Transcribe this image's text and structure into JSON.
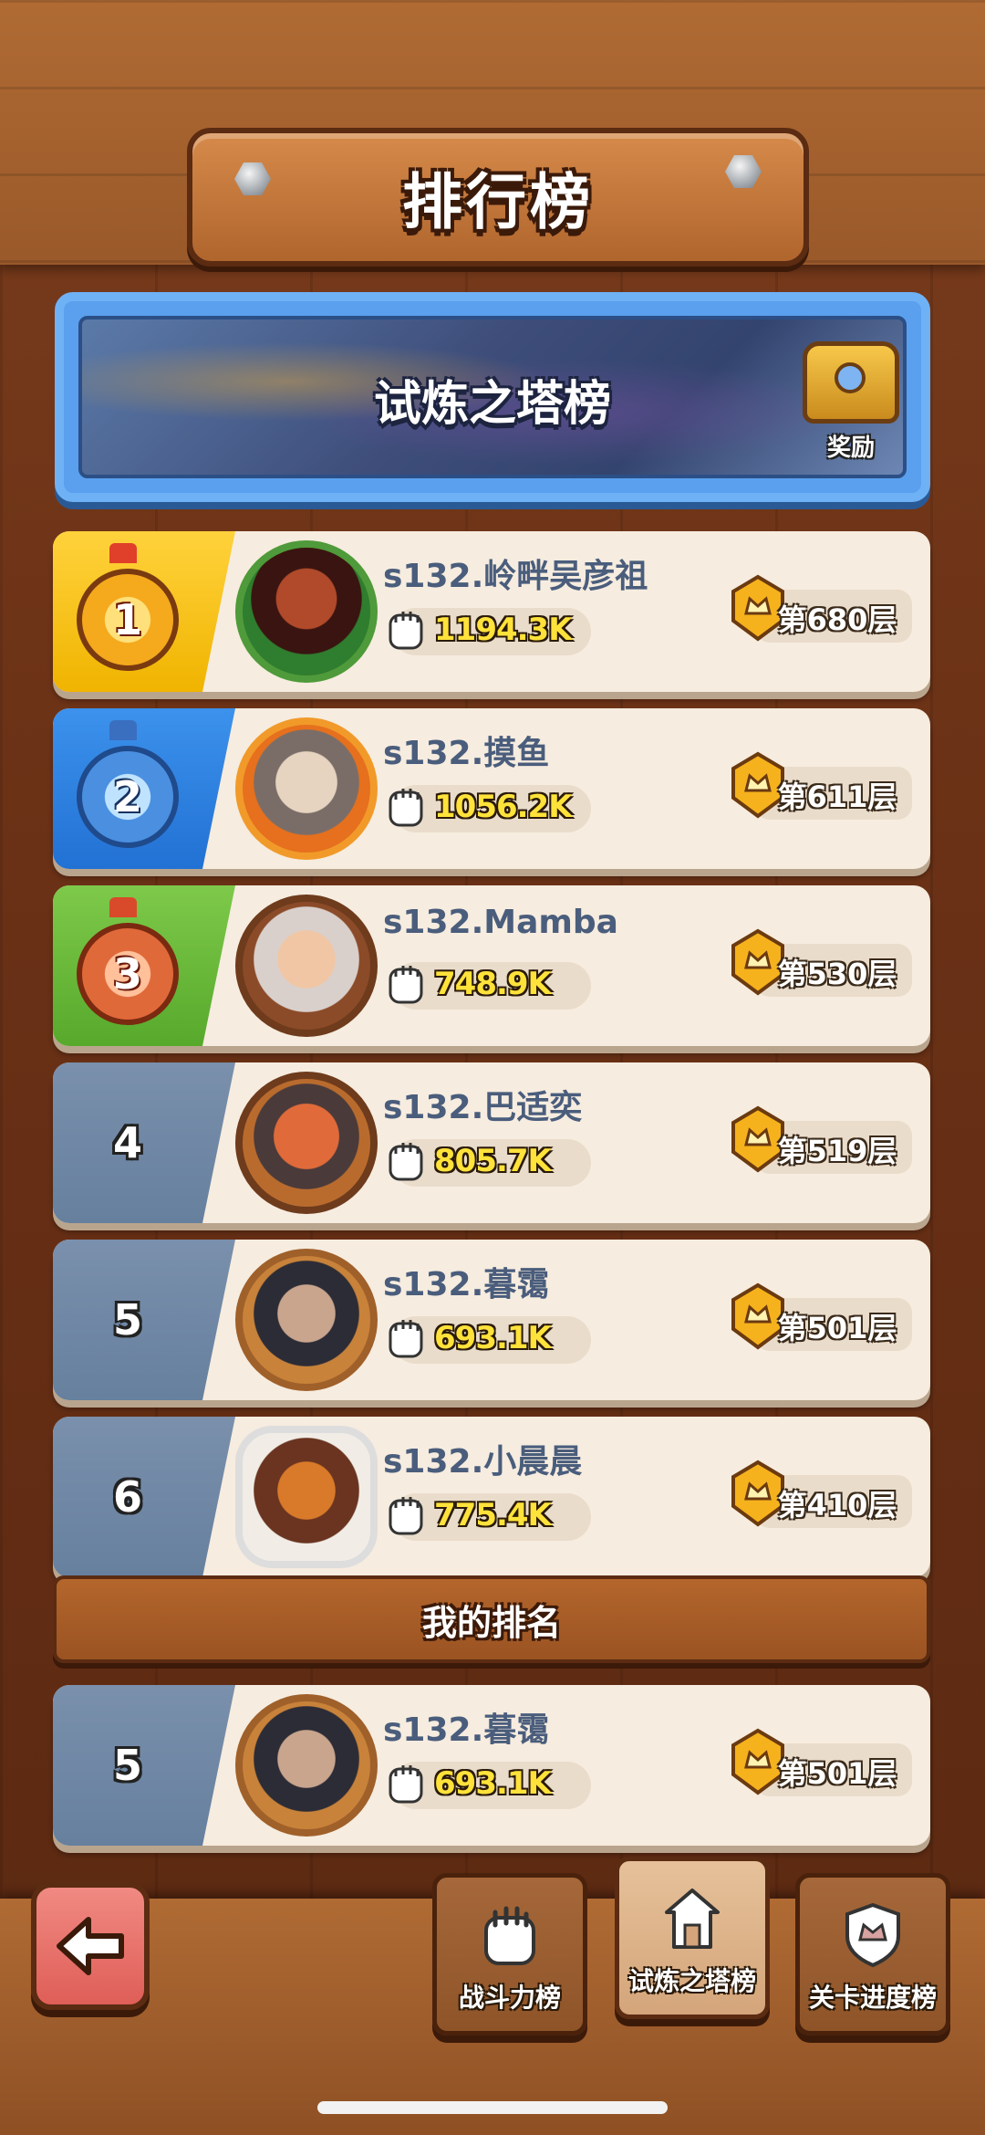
{
  "header": {
    "title": "排行榜"
  },
  "banner": {
    "title": "试炼之塔榜",
    "reward_label": "奖励"
  },
  "rows": [
    {
      "rank": "1",
      "name": "s132.岭畔吴彦祖",
      "power": "1194.3K",
      "floor": "第680层",
      "medal": "gold"
    },
    {
      "rank": "2",
      "name": "s132.摸鱼",
      "power": "1056.2K",
      "floor": "第611层",
      "medal": "silver"
    },
    {
      "rank": "3",
      "name": "s132.Mamba",
      "power": "748.9K",
      "floor": "第530层",
      "medal": "bronze"
    },
    {
      "rank": "4",
      "name": "s132.巴适奕",
      "power": "805.7K",
      "floor": "第519层"
    },
    {
      "rank": "5",
      "name": "s132.暮霭",
      "power": "693.1K",
      "floor": "第501层"
    },
    {
      "rank": "6",
      "name": "s132.小晨晨",
      "power": "775.4K",
      "floor": "第410层"
    }
  ],
  "my_rank": {
    "label": "我的排名",
    "rank": "5",
    "name": "s132.暮霭",
    "power": "693.1K",
    "floor": "第501层"
  },
  "tabs": [
    {
      "label": "战斗力榜",
      "icon": "fist-icon"
    },
    {
      "label": "试炼之塔榜",
      "icon": "tower-icon",
      "active": true
    },
    {
      "label": "关卡进度榜",
      "icon": "crown-shield-icon"
    }
  ],
  "colors": {
    "gold": "#f0b400",
    "blue": "#2271d4",
    "green": "#57a92c",
    "slate": "#66809e",
    "power_text": "#ffe23a"
  }
}
